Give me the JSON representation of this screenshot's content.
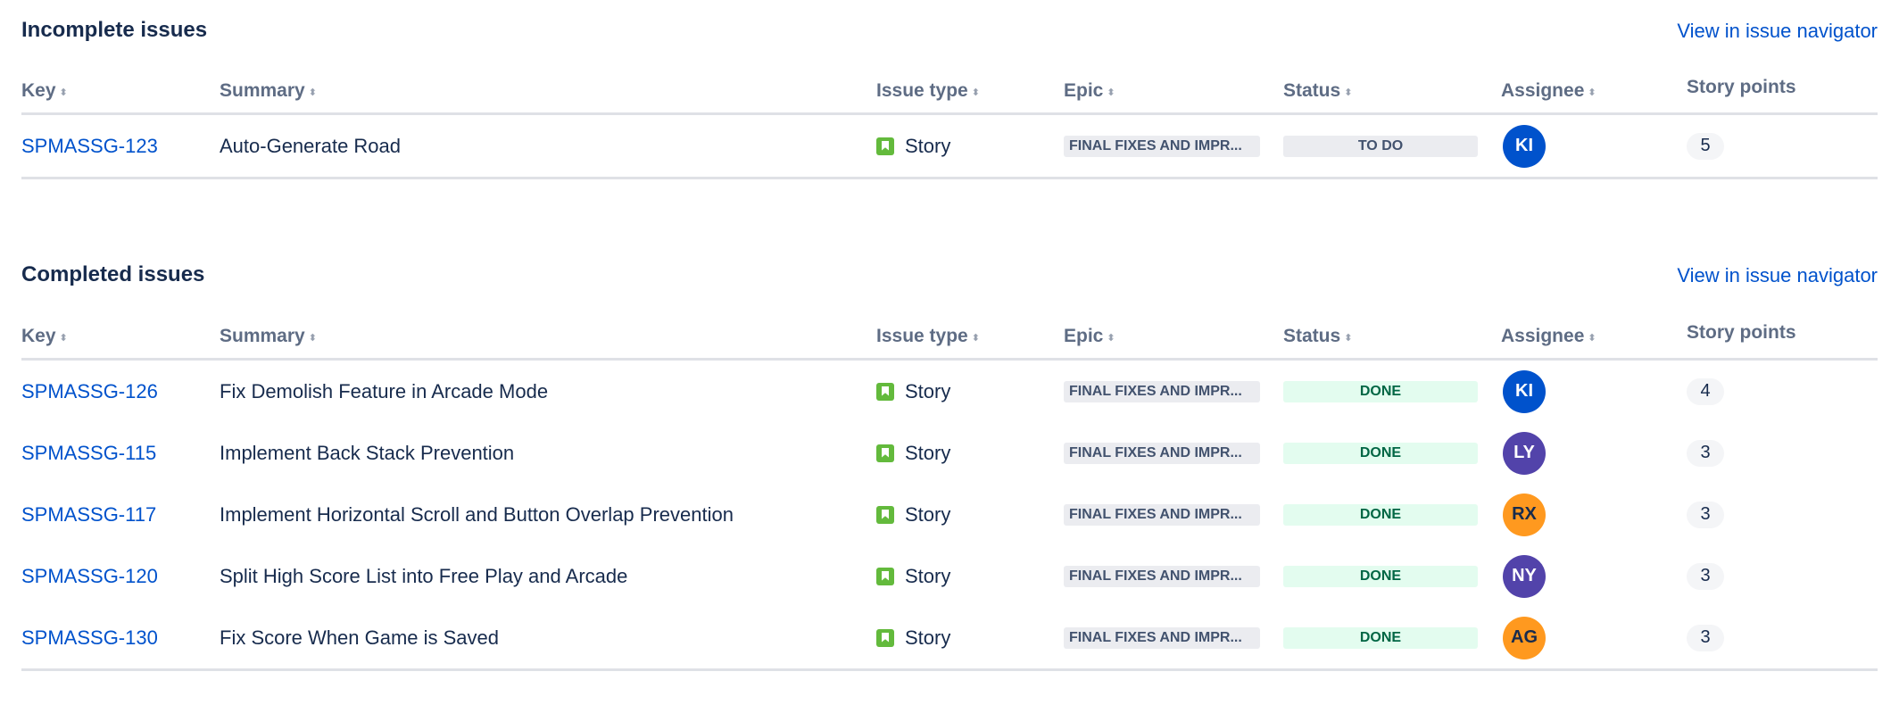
{
  "incomplete": {
    "title": "Incomplete issues",
    "nav_link": "View in issue navigator",
    "columns": [
      "Key",
      "Summary",
      "Issue type",
      "Epic",
      "Status",
      "Assignee",
      "Story points"
    ],
    "rows": [
      {
        "key": "SPMASSG-123",
        "summary": "Auto-Generate Road",
        "type": "Story",
        "epic": "FINAL FIXES AND IMPR...",
        "status": "TO DO",
        "assignee": "KI",
        "points": "5"
      }
    ]
  },
  "completed": {
    "title": "Completed issues",
    "nav_link": "View in issue navigator",
    "columns": [
      "Key",
      "Summary",
      "Issue type",
      "Epic",
      "Status",
      "Assignee",
      "Story points"
    ],
    "rows": [
      {
        "key": "SPMASSG-126",
        "summary": "Fix Demolish Feature in Arcade Mode",
        "type": "Story",
        "epic": "FINAL FIXES AND IMPR...",
        "status": "DONE",
        "assignee": "KI",
        "points": "4"
      },
      {
        "key": "SPMASSG-115",
        "summary": "Implement Back Stack Prevention",
        "type": "Story",
        "epic": "FINAL FIXES AND IMPR...",
        "status": "DONE",
        "assignee": "LY",
        "points": "3"
      },
      {
        "key": "SPMASSG-117",
        "summary": "Implement Horizontal Scroll and Button Overlap Prevention",
        "type": "Story",
        "epic": "FINAL FIXES AND IMPR...",
        "status": "DONE",
        "assignee": "RX",
        "points": "3"
      },
      {
        "key": "SPMASSG-120",
        "summary": "Split High Score List into Free Play and Arcade",
        "type": "Story",
        "epic": "FINAL FIXES AND IMPR...",
        "status": "DONE",
        "assignee": "NY",
        "points": "3"
      },
      {
        "key": "SPMASSG-130",
        "summary": "Fix Score When Game is Saved",
        "type": "Story",
        "epic": "FINAL FIXES AND IMPR...",
        "status": "DONE",
        "assignee": "AG",
        "points": "3"
      }
    ]
  },
  "colors": {
    "link": "#0052cc",
    "story_icon": "#63ba3c",
    "avatar_KI": "#0052cc",
    "avatar_LY": "#5243aa",
    "avatar_RX": "#ff991f",
    "avatar_NY": "#5243aa",
    "avatar_AG": "#ff991f",
    "avatar_text_RX": "#172b4d",
    "avatar_text_AG": "#172b4d"
  },
  "icons": {
    "issue_type": "story-bookmark-icon",
    "sort": "sort-arrows-icon"
  }
}
